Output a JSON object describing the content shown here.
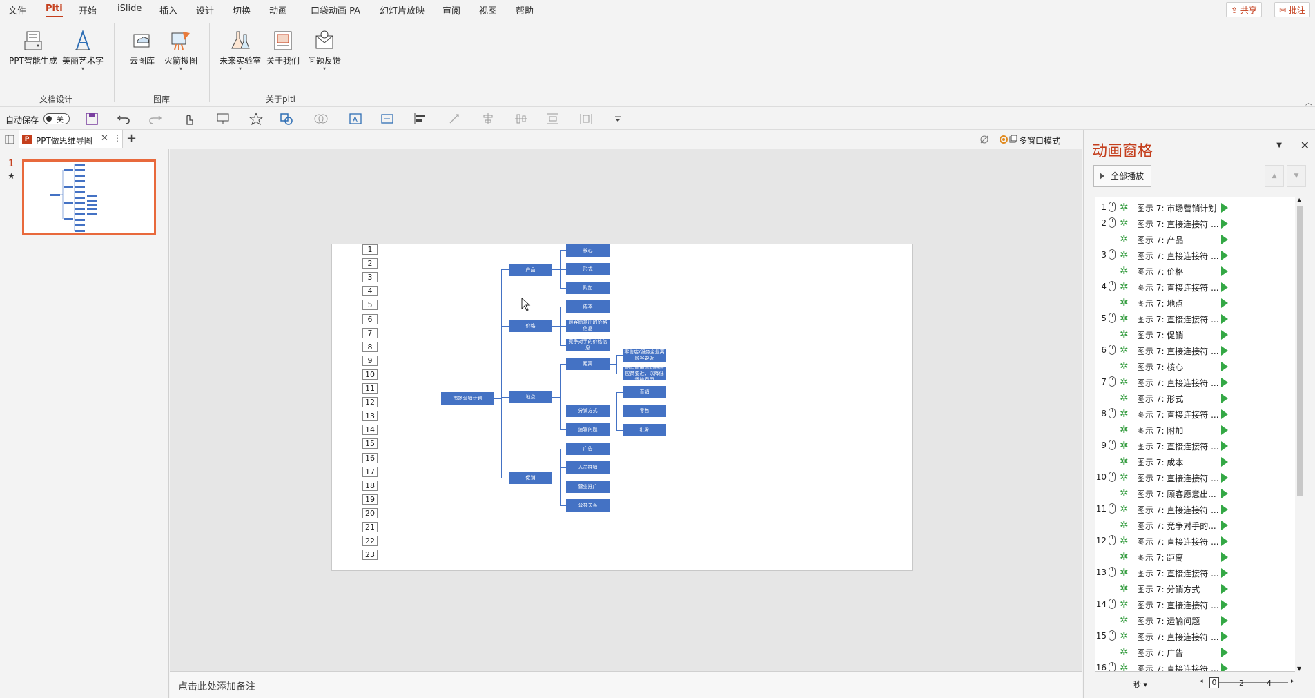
{
  "ribbon_tabs": [
    "文件",
    "Piti",
    "开始",
    "iSlide",
    "插入",
    "设计",
    "切换",
    "动画",
    "口袋动画 PA",
    "幻灯片放映",
    "审阅",
    "视图",
    "帮助"
  ],
  "active_tab": "Piti",
  "share_label": "共享",
  "comment_label": "批注",
  "ribbon": {
    "ppt_gen": "PPT智能生成",
    "art_text": "美丽艺术字",
    "cloud_lib": "云图库",
    "rocket_search": "火箭搜图",
    "lab": "未来实验室",
    "about": "关于我们",
    "feedback": "问题反馈",
    "group_doc": "文档设计",
    "group_lib": "图库",
    "group_about": "关于piti"
  },
  "qat": {
    "autosave": "自动保存",
    "toggle_state": "关"
  },
  "doc": {
    "tab_name": "PPT做思维导图",
    "multi_window": "多窗口模式",
    "slide_number": "1",
    "slide_star": "★",
    "notes_placeholder": "点击此处添加备注"
  },
  "slide": {
    "numbers": [
      "1",
      "2",
      "3",
      "4",
      "5",
      "6",
      "7",
      "8",
      "9",
      "10",
      "11",
      "12",
      "13",
      "14",
      "15",
      "16",
      "17",
      "18",
      "19",
      "20",
      "21",
      "22",
      "23"
    ],
    "root": "市场营销计划",
    "level1": [
      "产品",
      "价格",
      "地点",
      "促销"
    ],
    "level2": [
      "核心",
      "形式",
      "附加",
      "成本",
      "顾客愿意出的价格信息",
      "竞争对手的价格信息",
      "距离",
      "分销方式",
      "运输问题",
      "广告",
      "人员推销",
      "营业推广",
      "公共关系"
    ],
    "level3": [
      "零售店/服务企业离顾客要近",
      "制造商离原材料供应商要近，以降低运输费用",
      "直销",
      "零售",
      "批发"
    ]
  },
  "animation_pane": {
    "title": "动画窗格",
    "play_all": "全部播放",
    "rows": [
      {
        "num": "1",
        "mouse": true,
        "text": "图示 7: 市场营销计划"
      },
      {
        "num": "2",
        "mouse": true,
        "text": "图示 7: 直接连接符 ..."
      },
      {
        "num": "",
        "mouse": false,
        "text": "图示 7: 产品"
      },
      {
        "num": "3",
        "mouse": true,
        "text": "图示 7: 直接连接符 ..."
      },
      {
        "num": "",
        "mouse": false,
        "text": "图示 7: 价格"
      },
      {
        "num": "4",
        "mouse": true,
        "text": "图示 7: 直接连接符 ..."
      },
      {
        "num": "",
        "mouse": false,
        "text": "图示 7: 地点"
      },
      {
        "num": "5",
        "mouse": true,
        "text": "图示 7: 直接连接符 ..."
      },
      {
        "num": "",
        "mouse": false,
        "text": "图示 7: 促销"
      },
      {
        "num": "6",
        "mouse": true,
        "text": "图示 7: 直接连接符 ..."
      },
      {
        "num": "",
        "mouse": false,
        "text": "图示 7: 核心"
      },
      {
        "num": "7",
        "mouse": true,
        "text": "图示 7: 直接连接符 ..."
      },
      {
        "num": "",
        "mouse": false,
        "text": "图示 7: 形式"
      },
      {
        "num": "8",
        "mouse": true,
        "text": "图示 7: 直接连接符 ..."
      },
      {
        "num": "",
        "mouse": false,
        "text": "图示 7: 附加"
      },
      {
        "num": "9",
        "mouse": true,
        "text": "图示 7: 直接连接符 ..."
      },
      {
        "num": "",
        "mouse": false,
        "text": "图示 7: 成本"
      },
      {
        "num": "10",
        "mouse": true,
        "text": "图示 7: 直接连接符 ..."
      },
      {
        "num": "",
        "mouse": false,
        "text": "图示 7: 顾客愿意出..."
      },
      {
        "num": "11",
        "mouse": true,
        "text": "图示 7: 直接连接符 ..."
      },
      {
        "num": "",
        "mouse": false,
        "text": "图示 7: 竞争对手的..."
      },
      {
        "num": "12",
        "mouse": true,
        "text": "图示 7: 直接连接符 ..."
      },
      {
        "num": "",
        "mouse": false,
        "text": "图示 7: 距离"
      },
      {
        "num": "13",
        "mouse": true,
        "text": "图示 7: 直接连接符 ..."
      },
      {
        "num": "",
        "mouse": false,
        "text": "图示 7: 分销方式"
      },
      {
        "num": "14",
        "mouse": true,
        "text": "图示 7: 直接连接符 ..."
      },
      {
        "num": "",
        "mouse": false,
        "text": "图示 7: 运输问题"
      },
      {
        "num": "15",
        "mouse": true,
        "text": "图示 7: 直接连接符 ..."
      },
      {
        "num": "",
        "mouse": false,
        "text": "图示 7: 广告"
      },
      {
        "num": "16",
        "mouse": true,
        "text": "图示 7: 直接连接符 ..."
      }
    ],
    "timeline": {
      "unit": "秒 ▾",
      "t0": "0",
      "t2": "2",
      "t4": "4"
    }
  },
  "colors": {
    "accent": "#c43e1c",
    "node": "#4472c4",
    "play": "#34a845"
  }
}
